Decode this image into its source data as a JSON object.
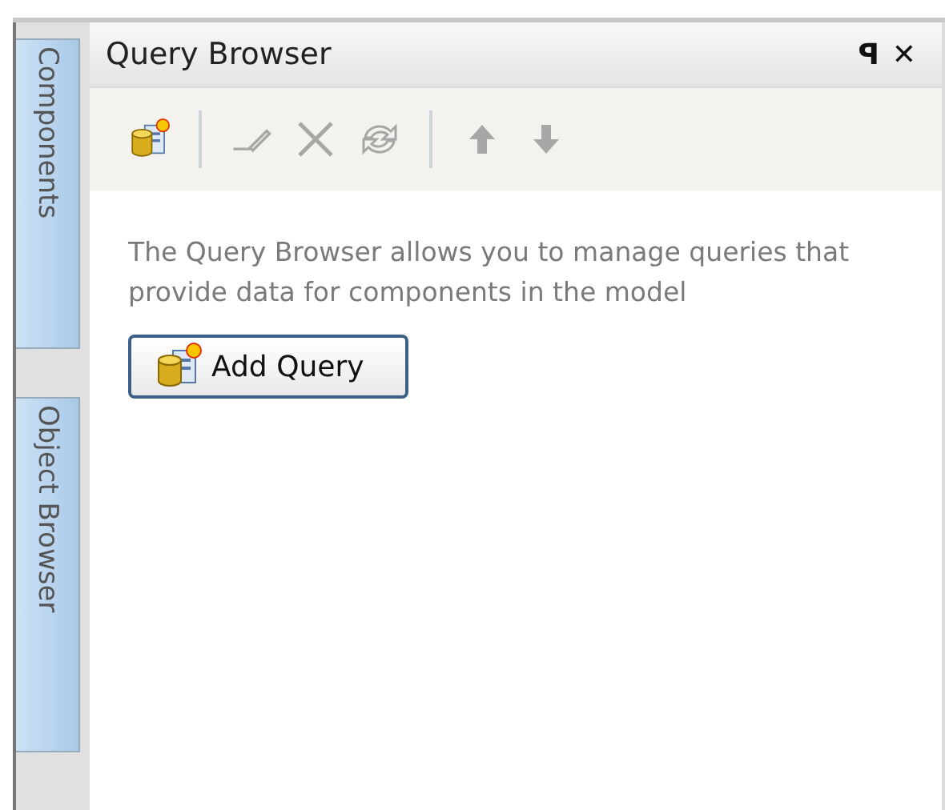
{
  "side_tabs": [
    {
      "label": "Components",
      "selected": false
    },
    {
      "label": "Object Browser",
      "selected": false
    }
  ],
  "panel": {
    "title": "Query Browser",
    "pin_glyph": "ꟼ",
    "close_glyph": "✕"
  },
  "toolbar": [
    {
      "kind": "add",
      "disabled": false
    },
    {
      "kind": "separator"
    },
    {
      "kind": "edit",
      "disabled": true
    },
    {
      "kind": "delete",
      "disabled": true
    },
    {
      "kind": "refresh",
      "disabled": true
    },
    {
      "kind": "separator"
    },
    {
      "kind": "up",
      "disabled": true
    },
    {
      "kind": "down",
      "disabled": true
    }
  ],
  "description": "The Query Browser allows you to manage queries that provide data for components in the model",
  "add_button": {
    "label": "Add Query"
  }
}
